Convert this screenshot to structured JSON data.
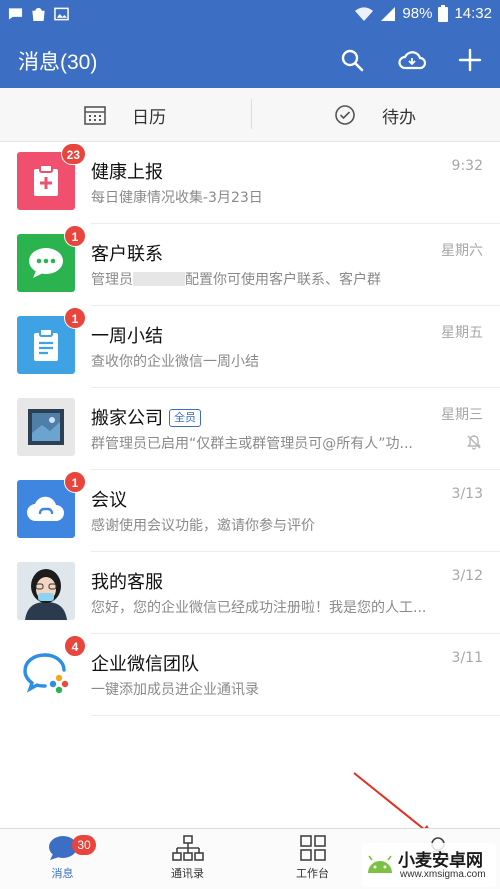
{
  "statusbar": {
    "battery": "98%",
    "time": "14:32",
    "icons": [
      "message-icon",
      "bag-icon",
      "image-icon",
      "wifi-icon",
      "signal-icon",
      "battery-icon"
    ]
  },
  "header": {
    "title": "消息(30)",
    "actions": [
      "search-icon",
      "cloud-icon",
      "plus-icon"
    ]
  },
  "quickbar": {
    "calendar_label": "日历",
    "todo_label": "待办"
  },
  "messages": [
    {
      "name": "健康上报",
      "subtitle": "每日健康情况收集-3月23日",
      "time": "9:32",
      "badge": "23",
      "icon": "health-report-icon",
      "color": "#f0506e"
    },
    {
      "name": "客户联系",
      "subtitle_a": "管理员",
      "subtitle_b": "配置你可使用客户联系、客户群",
      "time": "星期六",
      "badge": "1",
      "icon": "chat-bubble-icon",
      "color": "#2bb34f"
    },
    {
      "name": "一周小结",
      "subtitle": "查收你的企业微信一周小结",
      "time": "星期五",
      "badge": "1",
      "icon": "clipboard-icon",
      "color": "#3fa2e4"
    },
    {
      "name": "搬家公司",
      "tag": "全员",
      "subtitle": "群管理员已启用“仅群主或群管理员可@所有人”功...",
      "time": "星期三",
      "icon": "group-avatar-icon",
      "muted_icon": "bell-off-icon"
    },
    {
      "name": "会议",
      "subtitle": "感谢使用会议功能，邀请你参与评价",
      "time": "3/13",
      "badge": "1",
      "icon": "meeting-cloud-icon",
      "color": "#3f86e0"
    },
    {
      "name": "我的客服",
      "subtitle": "您好，您的企业微信已经成功注册啦！我是您的人工...",
      "time": "3/12",
      "icon": "service-agent-avatar-icon"
    },
    {
      "name": "企业微信团队",
      "subtitle": "一键添加成员进企业通讯录",
      "time": "3/11",
      "badge": "4",
      "icon": "wecom-logo-icon"
    }
  ],
  "bottomnav": {
    "items": [
      {
        "label": "消息",
        "icon": "message-icon",
        "badge": "30"
      },
      {
        "label": "通讯录",
        "icon": "contacts-tree-icon"
      },
      {
        "label": "工作台",
        "icon": "workbench-grid-icon"
      },
      {
        "label": "",
        "icon": "me-icon"
      }
    ]
  },
  "watermark": {
    "title": "小麦安卓网",
    "url": "www.xmsigma.com"
  },
  "colors": {
    "brand_blue": "#3c6ec4",
    "badge_red": "#e8453c"
  }
}
